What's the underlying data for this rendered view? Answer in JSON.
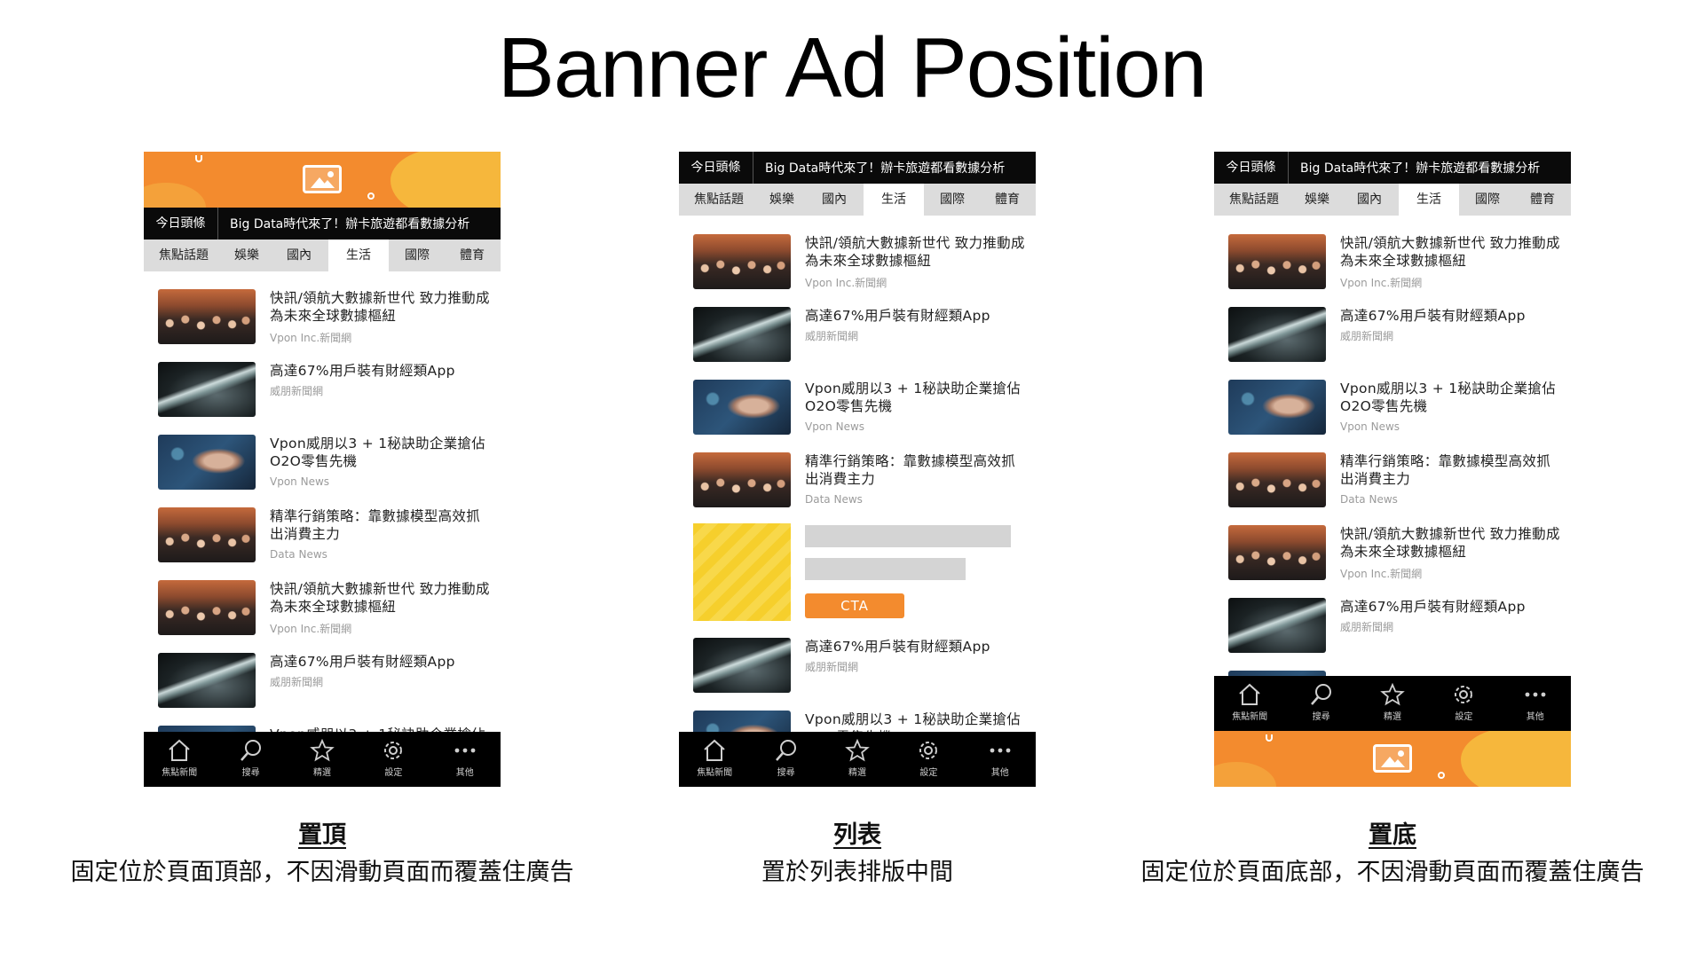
{
  "page": {
    "title": "Banner Ad Position"
  },
  "app": {
    "headline_label": "今日頭條",
    "headline_text": "Big Data時代來了！辦卡旅遊都看數據分析",
    "tabs": [
      "焦點話題",
      "娛樂",
      "國內",
      "生活",
      "國際",
      "體育"
    ],
    "active_tab": "生活",
    "nav": [
      {
        "label": "焦點新聞",
        "icon": "home-icon"
      },
      {
        "label": "搜尋",
        "icon": "search-icon"
      },
      {
        "label": "精選",
        "icon": "star-icon"
      },
      {
        "label": "設定",
        "icon": "gear-icon"
      },
      {
        "label": "其他",
        "icon": "more-icon"
      }
    ]
  },
  "news_items": [
    {
      "title": "快訊/領航大數據新世代 致力推動成為未來全球數據樞紐",
      "source": "Vpon Inc.新聞網",
      "thumb": "crowd"
    },
    {
      "title": "高達67%用戶裝有財經類App",
      "source": "威朋新聞網",
      "thumb": "tech"
    },
    {
      "title": "Vpon威朋以3 + 1秘訣助企業搶佔O2O零售先機",
      "source": "Vpon News",
      "thumb": "face"
    },
    {
      "title": "精準行銷策略：靠數據模型高效抓出消費主力",
      "source": "Data News",
      "thumb": "crowd"
    }
  ],
  "native_ad": {
    "cta": "CTA",
    "image_color": "#f6cf2c",
    "button_color": "#f38b2e"
  },
  "colors": {
    "banner": "#f38b2e",
    "banner_accent": "#f6b73c",
    "bar": "#0a0a0a",
    "tabs_bg": "#dcdcdc"
  },
  "panels": [
    {
      "heading": "置頂",
      "description": "固定位於頁面頂部，不因滑動頁面而覆蓋住廣告"
    },
    {
      "heading": "列表",
      "description": "置於列表排版中間"
    },
    {
      "heading": "置底",
      "description": "固定位於頁面底部，不因滑動頁面而覆蓋住廣告"
    }
  ]
}
